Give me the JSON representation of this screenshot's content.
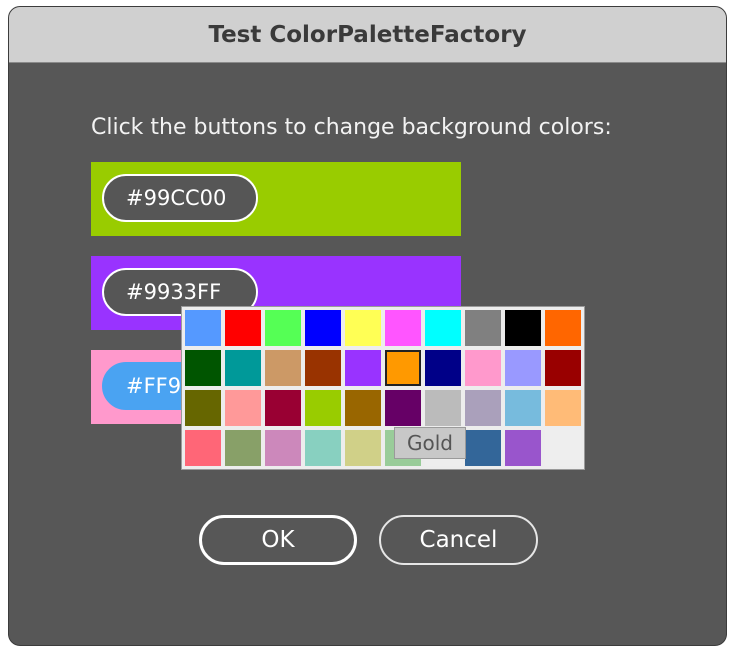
{
  "window": {
    "title": "Test ColorPaletteFactory"
  },
  "instruction": "Click the buttons to change background colors:",
  "color_rows": [
    {
      "background": "#99CC00",
      "button_label": "#99CC00"
    },
    {
      "background": "#9933FF",
      "button_label": "#9933FF"
    },
    {
      "background": "#FF99CC",
      "button_label": "#FF99CC"
    }
  ],
  "palette": {
    "hovered_swatch": "Gold",
    "rows": [
      [
        "#5599FF",
        "#FF0000",
        "#55FF55",
        "#0000FF",
        "#FFFF55",
        "#FF55FF",
        "#00FFFF",
        "#808080",
        "#000000",
        "#FF6600"
      ],
      [
        "#005500",
        "#009999",
        "#CC9966",
        "#993300",
        "#9933FF",
        "#FF9900",
        "#000088",
        "#FF99CC",
        "#9999FF",
        "#990000"
      ],
      [
        "#666600",
        "#FF9999",
        "#990033",
        "#99CC00",
        "#996600",
        "#660066",
        "#BBBBBB",
        "#AAA0BB",
        "#77BBDD",
        "#FFBB77"
      ],
      [
        "#FF6677",
        "#88A068",
        "#CC88BB",
        "#88D0C0",
        "#D0D088",
        "#99CC99",
        "#EEEEEE",
        "#336699",
        "#9955CC",
        "#EEEEEE"
      ]
    ]
  },
  "tooltip": "Gold",
  "buttons": {
    "ok": "OK",
    "cancel": "Cancel"
  }
}
